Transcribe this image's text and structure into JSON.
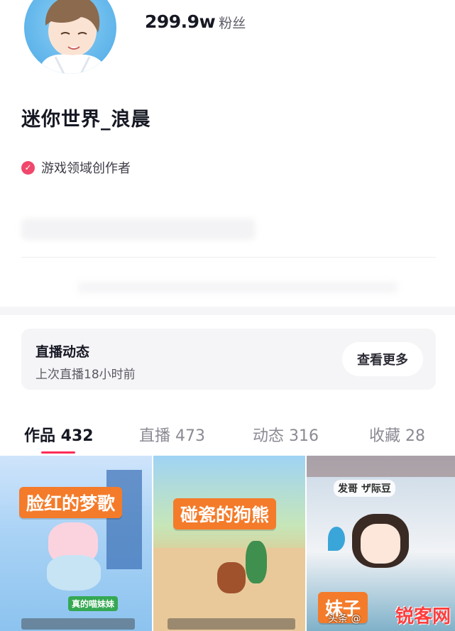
{
  "profile": {
    "avatar_name": "avatar",
    "followers_count": "299.9w",
    "followers_label": "粉丝",
    "username": "迷你世界_浪晨",
    "verified_label": "游戏领域创作者"
  },
  "live": {
    "title": "直播动态",
    "subtitle": "上次直播18小时前",
    "more_button": "查看更多"
  },
  "tabs": [
    {
      "label": "作品 432",
      "active": true
    },
    {
      "label": "直播 473",
      "active": false
    },
    {
      "label": "动态 316",
      "active": false
    },
    {
      "label": "收藏 28",
      "active": false
    }
  ],
  "videos": [
    {
      "caption": "脸红的梦歌",
      "overlay": "真的喵妹妹"
    },
    {
      "caption": "碰瓷的狗熊",
      "overlay": ""
    },
    {
      "caption": "妹子",
      "overlay": "发哥 ザ际豆"
    }
  ],
  "watermark": {
    "text": "锐客网",
    "small_text": "头条 @"
  },
  "colors": {
    "accent": "#fe2c55",
    "verified": "#f0476b",
    "caption_bg": "#f47b2a"
  }
}
